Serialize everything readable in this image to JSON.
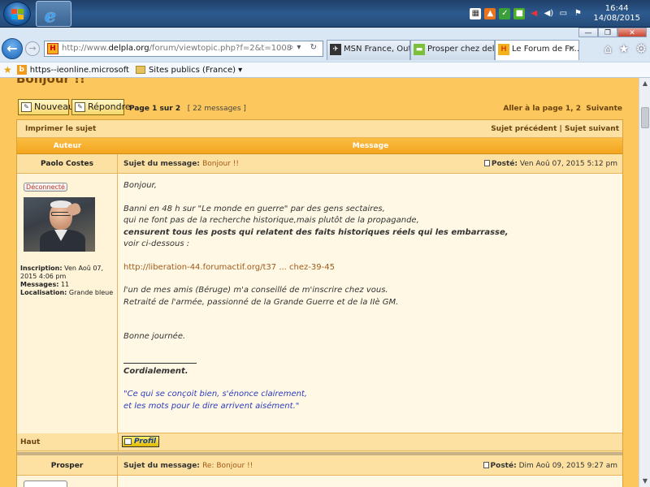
{
  "taskbar": {
    "clock_time": "16:44",
    "clock_date": "14/08/2015"
  },
  "browser": {
    "url_prefix": "http://www.",
    "url_domain": "delpla.org",
    "url_path": "/forum/viewtopic.php?f=2&t=1008",
    "tabs": [
      {
        "label": "MSN France, Outl...",
        "icon": "msn-icon"
      },
      {
        "label": "Prosper chez delpl...",
        "icon": "forum-comment-icon"
      },
      {
        "label": "Le Forum de Fr...",
        "icon": "site-h-icon"
      }
    ],
    "favorites": [
      {
        "label": "https--ieonline.microsoft",
        "icon": "bing-icon"
      },
      {
        "label": "Sites publics (France)",
        "icon": "folder-icon"
      }
    ]
  },
  "forum": {
    "page_title_cut": "Bonjour !!",
    "new_topic_label": "Nouveau",
    "reply_label": "Répondre",
    "page_of": "Page 1 sur 2",
    "messages_count": "[ 22 messages ]",
    "goto_label": "Aller à la page",
    "goto_page1": "1,",
    "goto_page2": "2",
    "goto_next": "Suivante",
    "print_topic": "Imprimer le sujet",
    "prev_topic": "Sujet précédent",
    "pipe": "|",
    "next_topic": "Sujet suivant",
    "col_author": "Auteur",
    "col_message": "Message",
    "subject_label": "Sujet du message:",
    "posted_label": "Posté:",
    "top_label": "Haut",
    "profile_label": "Profil"
  },
  "posts": [
    {
      "author": "Paolo Costes",
      "subject": "Bonjour !!",
      "date": "Ven Aoû 07, 2015 5:12 pm",
      "status": "Déconnecté",
      "inscription_label": "Inscription:",
      "inscription_value": "Ven Aoû 07, 2015 4:06 pm",
      "messages_label": "Messages:",
      "messages_value": "11",
      "location_label": "Localisation:",
      "location_value": "Grande bleue",
      "body": {
        "greeting": "Bonjour,",
        "l1": "Banni en 48 h sur \"Le monde en guerre\" par des gens sectaires,",
        "l2": "qui ne font pas de la recherche historique,mais plutôt de la propagande,",
        "l3": "censurent tous les posts qui relatent des faits historiques réels qui les embarrasse,",
        "l4": "voir ci-dessous :",
        "link": "http://liberation-44.forumactif.org/t37 ... chez-39-45",
        "l5": "l'un de mes amis (Béruge) m'a conseillé de m'inscrire chez vous.",
        "l6": "Retraité de l'armée, passionné de la Grande Guerre et de la IIè GM.",
        "l7": "Bonne journée.",
        "sig": "Cordialement.",
        "quote1": "\"Ce qui se conçoit bien, s'énonce clairement,",
        "quote2": "et les mots pour le dire arrivent aisément.\""
      }
    },
    {
      "author": "Prosper",
      "subject": "Re: Bonjour !!",
      "date": "Dim Aoû 09, 2015 9:27 am"
    }
  ]
}
